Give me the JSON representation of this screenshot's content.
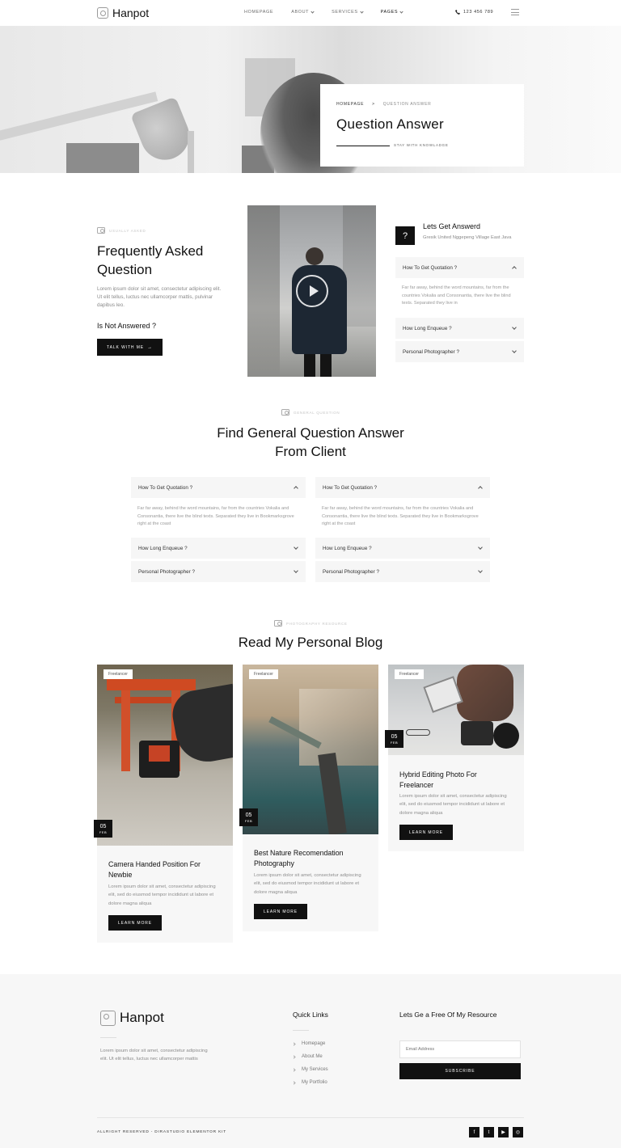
{
  "header": {
    "logo": "Hanpot",
    "nav": [
      "HOMEPAGE",
      "ABOUT",
      "SERVICES",
      "PAGES"
    ],
    "phone": "123 456 789"
  },
  "hero": {
    "breadcrumb_home": "HOMEPAGE",
    "breadcrumb_sep": ">",
    "breadcrumb_current": "QUESTION ANSWER",
    "title": "Question Answer",
    "subtitle": "STAY WITH KNOWLADGE"
  },
  "faq": {
    "tagline": "USUALLY ASKED",
    "title_line1": "Frequently Asked",
    "title_line2": "Question",
    "text": "Lorem ipsum dolor sit amet, consectetur adipiscing elit. Ut elit tellus, luctus nec ullamcorper mattis, pulvinar dapibus leo.",
    "not_answered": "Is Not Answered ?",
    "button": "TALK WITH ME",
    "box_icon": "?",
    "box_title": "Lets Get Answerd",
    "box_address": "Gresik United Nggepeng Village East Java",
    "accordion": [
      {
        "q": "How To Get Quotation ?",
        "a": "Far far away, behind the word mountains, far from the countries Vokalia and Consonantia, there live the blind texts. Separated they live in"
      },
      {
        "q": "How Long Enqueue ?"
      },
      {
        "q": "Personal Photographer ?"
      }
    ]
  },
  "general": {
    "tagline": "GENERAL QUESTION",
    "title_line1": "Find General Question Answer",
    "title_line2": "From Client",
    "left": [
      {
        "q": "How To Get Quotation ?",
        "a": "Far far away, behind the word mountains, far from the countries Vokalia and Consonantia, there live the blind texts. Separated they live in Bookmarksgrove right at the coast"
      },
      {
        "q": "How Long Enqueue ?"
      },
      {
        "q": "Personal Photographer ?"
      }
    ],
    "right": [
      {
        "q": "How To Get Quotation ?",
        "a": "Far far away, behind the word mountains, far from the countries Vokalia and Consonantia, there live the blind texts. Separated they live in Bookmarksgrove right at the coast"
      },
      {
        "q": "How Long Enqueue ?"
      },
      {
        "q": "Personal Photographer ?"
      }
    ]
  },
  "blog": {
    "tagline": "PHOTOGRAPHY RESOURCE",
    "title": "Read My Personal Blog",
    "posts": [
      {
        "badge": "Freelancer",
        "day": "05",
        "month": "FEB",
        "title_line1": "Camera Handed Position For",
        "title_line2": "Newbie",
        "text": "Lorem ipsum dolor sit amet, consectetur adipiscing elit, sed do eiusmod tempor incididunt ut labore et dolore magna aliqua",
        "button": "LEARN MORE"
      },
      {
        "badge": "Freelancer",
        "day": "05",
        "month": "FEB",
        "title_line1": "Best Nature Recomendation",
        "title_line2": "Photography",
        "text": "Lorem ipsum dolor sit amet, consectetur adipiscing elit, sed do eiusmod tempor incididunt ut labore et dolore magna aliqua",
        "button": "LEARN MORE"
      },
      {
        "badge": "Freelancer",
        "day": "05",
        "month": "FEB",
        "title_line1": "Hybrid Editing Photo For",
        "title_line2": "Freelancer",
        "text": "Lorem ipsum dolor sit amet, consectetur adipiscing elit, sed do eiusmod tempor incididunt ut labore et dolore magna aliqua",
        "button": "LEARN MORE"
      }
    ]
  },
  "footer": {
    "logo": "Hanpot",
    "text": "Lorem ipsum dolor sit amet, consectetur adipiscing elit. Ut elit tellus, luctus nec ullamcorper mattis",
    "quick_links_title": "Quick Links",
    "quick_links": [
      "Homepage",
      "About Me",
      "My Services",
      "My Portfolio"
    ],
    "resource_title": "Lets Ge a Free Of My Resource",
    "email_placeholder": "Email Address",
    "subscribe": "SUBSCRIBE",
    "copyright": "ALLRIGHT RESERVED - DIRASTUDIO ELEMENTOR KIT",
    "social": [
      "f",
      "t",
      "▶",
      "◎"
    ]
  }
}
